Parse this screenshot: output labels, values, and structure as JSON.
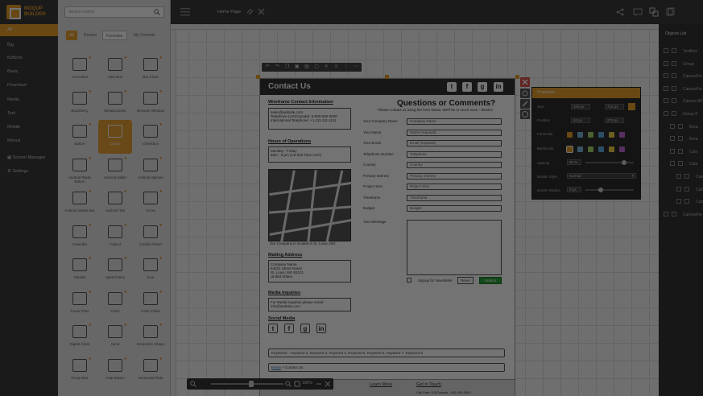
{
  "nav": {
    "logo_lines": [
      "MOQUP",
      "BUILDER"
    ],
    "items": [
      "All",
      "Big",
      "Buttons",
      "Basic",
      "Flowchart",
      "Media",
      "Text",
      "Mobile",
      "Menus"
    ],
    "screen_manager": "Screen Manager",
    "settings": "Settings"
  },
  "panel": {
    "search_placeholder": "Search control",
    "tabs": [
      "All",
      "Recent",
      "Favorites",
      "My Controls"
    ],
    "widgets": [
      [
        "Accordion",
        "Alert Box",
        "Bar Chart"
      ],
      [
        "Blackberry",
        "Breadcrumbs",
        "Browser Window"
      ],
      [
        "Button",
        "Cursor",
        "Checkbox"
      ],
      [
        "Android Radio Button",
        "Android Slider",
        "Android Spinner"
      ],
      [
        "Android Status Bar",
        "Android Tab",
        "Arrow"
      ],
      [
        "Calendar",
        "Callout",
        "Combo Panel"
      ],
      [
        "Datalist",
        "Speech Box",
        "Icon"
      ],
      [
        "Cover Flow",
        "Clock",
        "Color Picker"
      ],
      [
        "Digital Clock",
        "Send",
        "Geometric Shape"
      ],
      [
        "Group Box",
        "Help Button",
        "Horizontal Rule"
      ]
    ]
  },
  "topbar": {
    "tab_home": "Home Page"
  },
  "mockup": {
    "title": "Contact Us",
    "sections": {
      "contact_info_title": "Wireframe Contact Information",
      "contact_info_body": "sales@website.com\nTelephone (US/Canada): 0-000-000-0000\nInternational Telephone: +1-111-111-1111",
      "hours_title": "Hours of Operations",
      "hours_body": "Monday - Friday\n8am - 5 pm (Central Time USA)",
      "map_caption": "Our Company is located in St. Louis, MO",
      "mailing_title": "Mailing Address",
      "mailing_body": "Company Name\n54321 Street Name\nSt. Louis, MO 63101\nUnited States",
      "media_title": "Media Inquiries",
      "media_body": "For Media inquiries please email:\ninfo@website.com",
      "social_title": "Social Media"
    },
    "form": {
      "title": "Questions or Comments?",
      "subtitle": "Please contact us using the form below. We'll be in touch soon - thanks!",
      "fields": [
        {
          "label": "Your Company Name",
          "value": "Company Name"
        },
        {
          "label": "Your Name",
          "value": "Name (required)"
        },
        {
          "label": "Your Email",
          "value": "Email (required)"
        },
        {
          "label": "Telephone Number",
          "value": "Telephone"
        },
        {
          "label": "Country",
          "value": "Country"
        },
        {
          "label": "Primary Interest",
          "value": "Primary Interest"
        },
        {
          "label": "Project Size",
          "value": "Project Size"
        },
        {
          "label": "Timeframe",
          "value": "Timeframe"
        },
        {
          "label": "Budget",
          "value": "Budget"
        }
      ],
      "message_label": "Your Message",
      "newsletter": "Signup for Newsletter",
      "reset": "Reset",
      "submit": "Submit"
    },
    "keywords_bar": "Keyword1 - Keyword 2, Keyword 3, Keyword 4, Keyword 5, Keyword 6, Keyword 7, Keyword 8",
    "breadcrumb_home": "Home",
    "breadcrumb_current": "> Contact Us",
    "footer_learn": "Learn More",
    "footer_touch": "Get in Touch",
    "footer_phone": "Call Free: US/Canada - 000-000-0000"
  },
  "properties": {
    "title": "Properties",
    "size_label": "Size",
    "size_w": "340 px",
    "size_h": "712 px",
    "position_label": "Position",
    "pos_x": "40 px",
    "pos_y": "270 px",
    "fontcolor_label": "FontColor",
    "backcolor_label": "BackColor",
    "opacity_label": "Opacity",
    "opacity_value": "80 %",
    "opacity_fraction": 0.8,
    "border_style_label": "Border Style",
    "border_style_value": "Normal",
    "border_radius_label": "Border Radius",
    "border_radius_value": "0 px",
    "swatches": [
      "#e89f2c",
      "#7abbe0",
      "#a8d86e",
      "#5fb0e8",
      "#f2d04a",
      "#c06ad8"
    ]
  },
  "objects": {
    "title": "Objects List",
    "items": [
      "TextBox",
      "Group",
      "CanvasFw",
      "CanvasFw",
      "Canvas BF",
      "Group 8",
      "Brea",
      "Brea",
      "Cale",
      "Cate",
      "Cam",
      "Call",
      "Cam",
      "CanvasFw"
    ]
  },
  "zoom": {
    "value": "100%",
    "level_fraction": 0.55
  }
}
